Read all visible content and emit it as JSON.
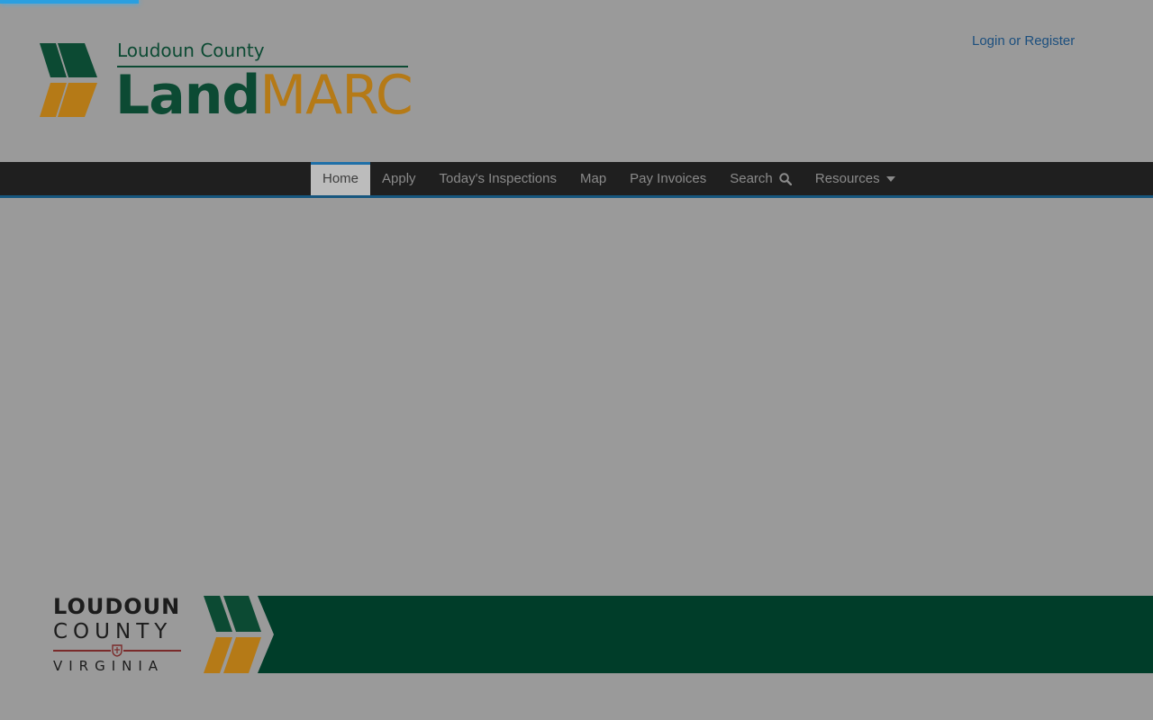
{
  "header": {
    "logo_county": "Loudoun County",
    "logo_land": "Land",
    "logo_marc": "MARC",
    "login_label": "Login or Register"
  },
  "nav": {
    "items": [
      {
        "label": "Home",
        "active": true
      },
      {
        "label": "Apply"
      },
      {
        "label": "Today's Inspections"
      },
      {
        "label": "Map"
      },
      {
        "label": "Pay Invoices"
      },
      {
        "label": "Search",
        "icon": "search-icon"
      },
      {
        "label": "Resources",
        "icon": "caret-down-icon"
      }
    ]
  },
  "footer": {
    "logo_line1": "LOUDOUN",
    "logo_line2": "COUNTY",
    "logo_line3": "VIRGINIA"
  },
  "colors": {
    "brand_green": "#0c4a33",
    "brand_gold": "#b57a17",
    "nav_bg": "#1f1f1f",
    "nav_active_bg": "#bcbcbc",
    "link": "#1c4f7e",
    "footer_band": "#003d29"
  },
  "loading_progress": 0.12
}
